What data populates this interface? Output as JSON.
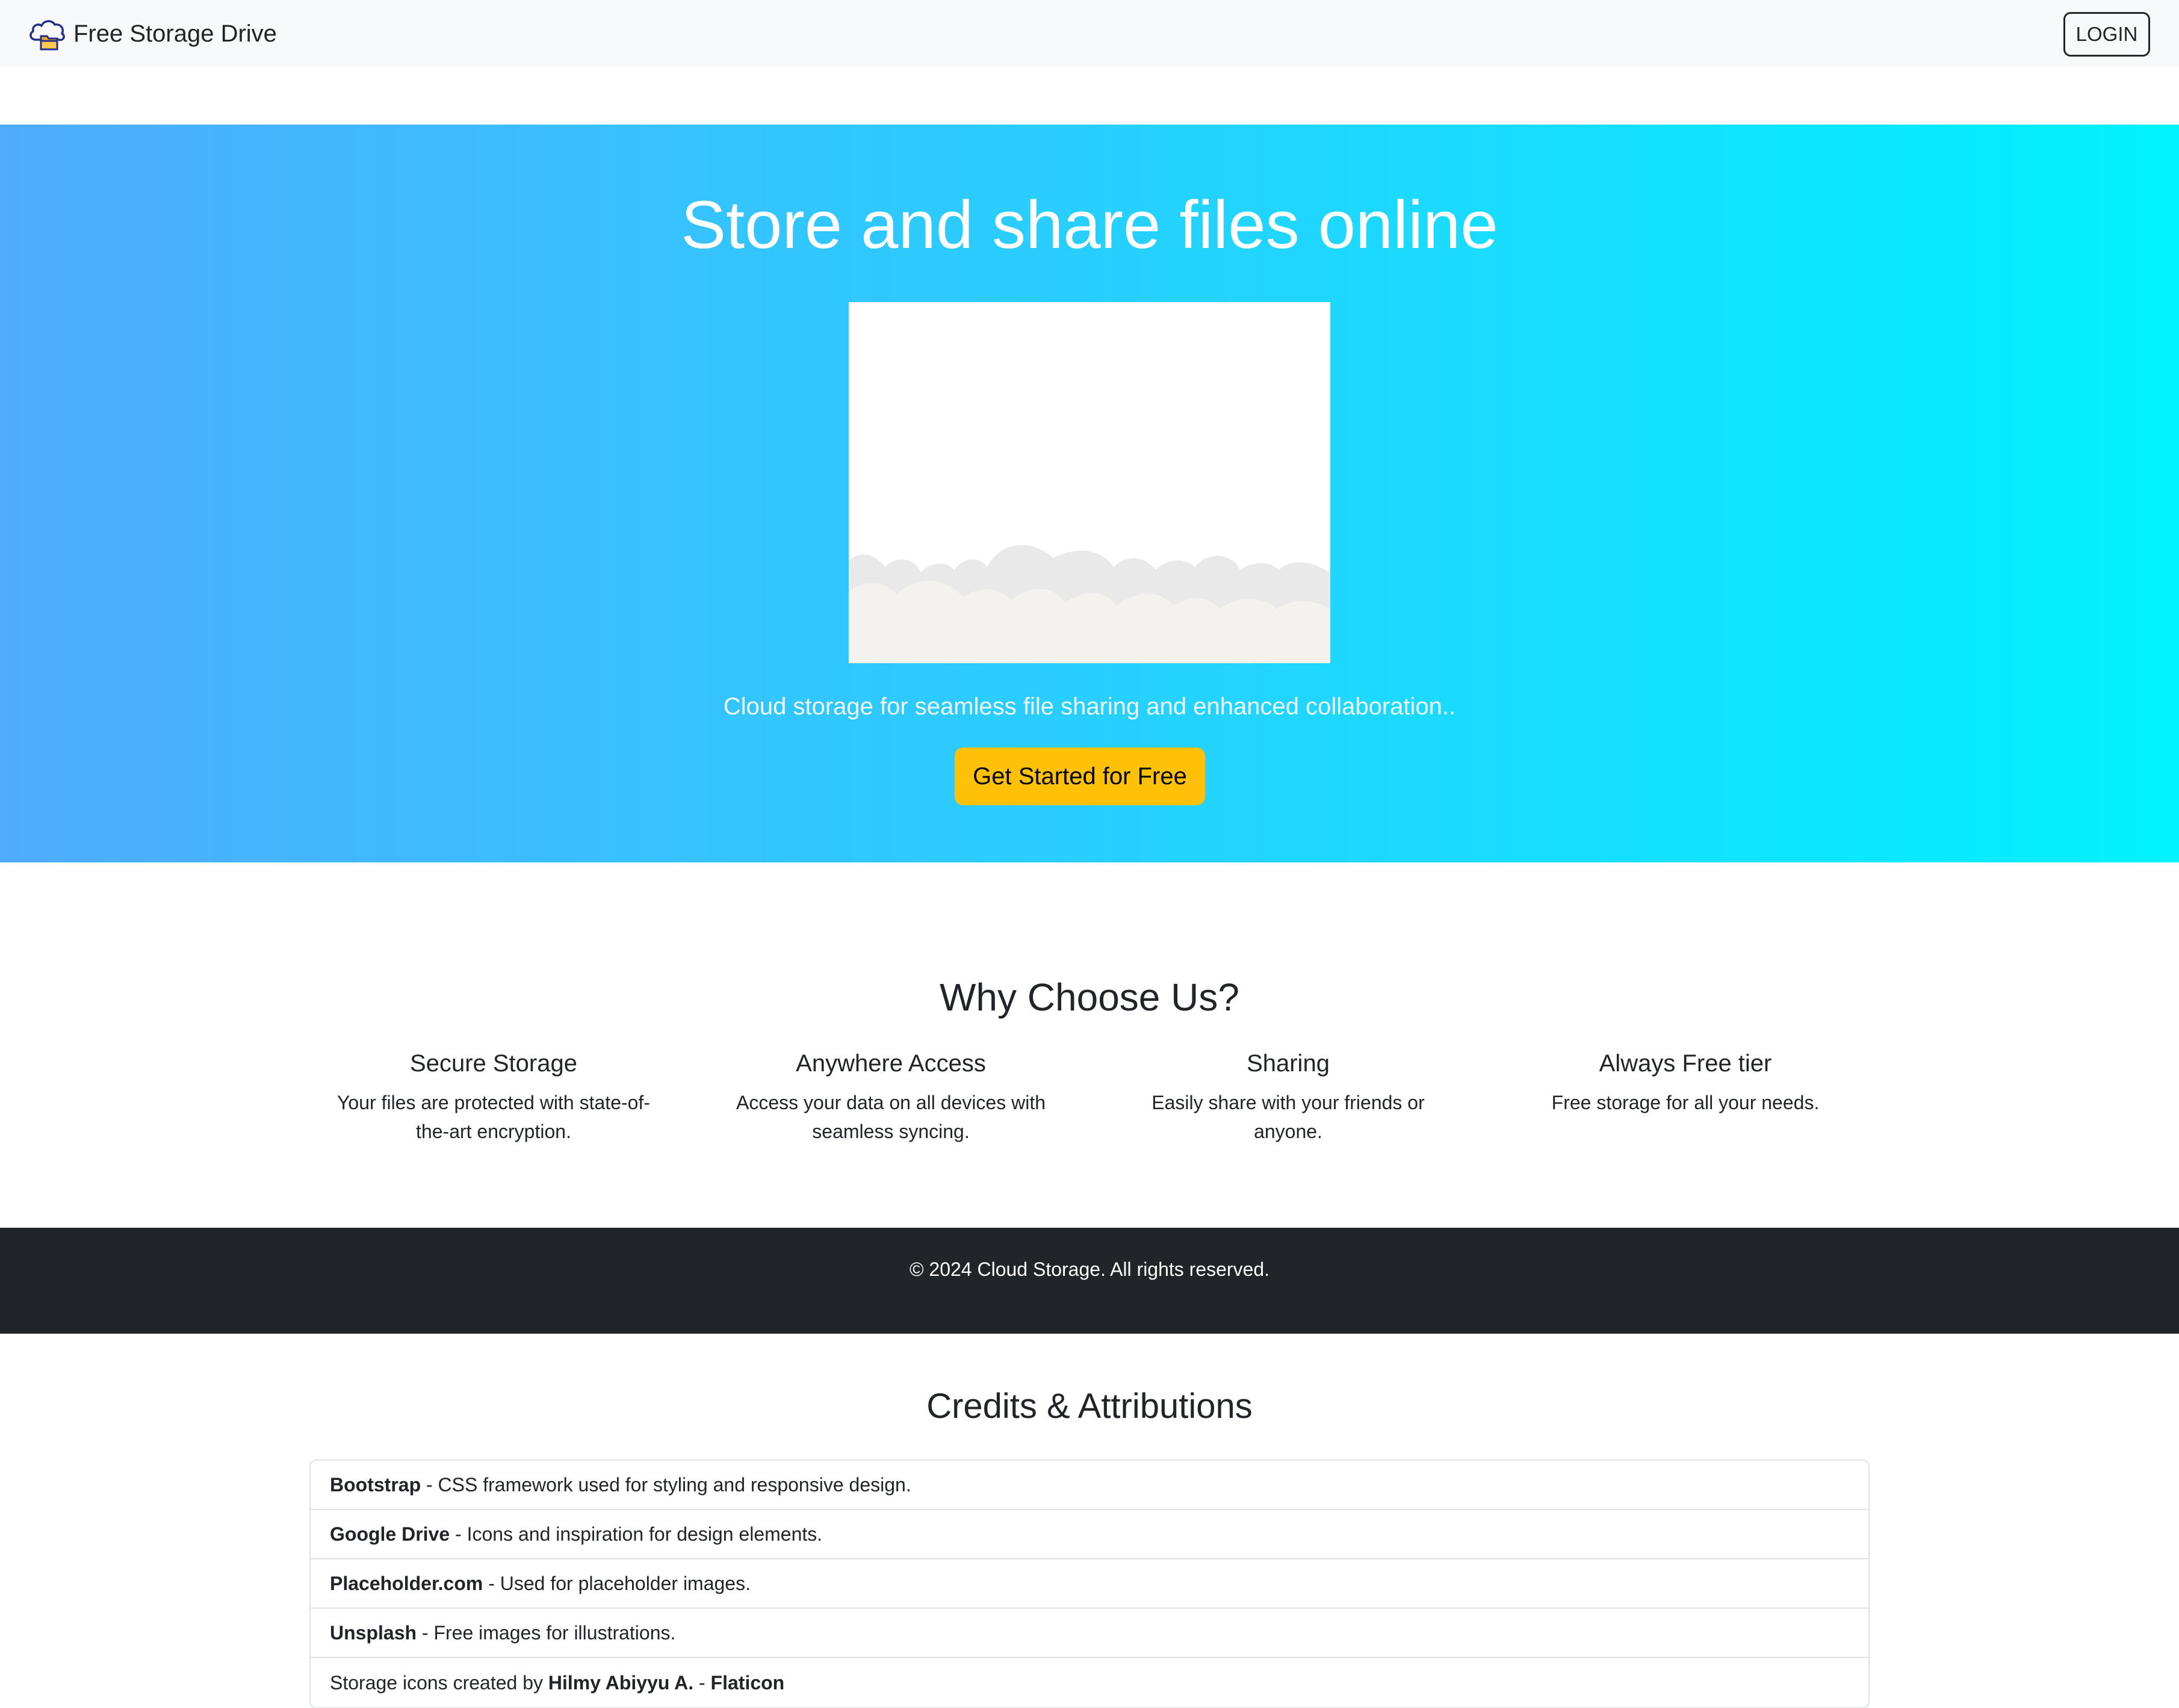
{
  "navbar": {
    "brand": "Free Storage Drive",
    "brand_icon": "cloud-folder-icon",
    "login_label": "LOGIN"
  },
  "hero": {
    "title": "Store and share files online",
    "subtitle": "Cloud storage for seamless file sharing and enhanced collaboration..",
    "cta_label": "Get Started for Free",
    "gradient_from": "#4facfe",
    "gradient_to": "#00f2fe",
    "cta_color": "#ffc107"
  },
  "why": {
    "title": "Why Choose Us?",
    "features": [
      {
        "title": "Secure Storage",
        "desc": "Your files are protected with state-of-the-art encryption."
      },
      {
        "title": "Anywhere Access",
        "desc": "Access your data on all devices with seamless syncing."
      },
      {
        "title": "Sharing",
        "desc": "Easily share with your friends or anyone."
      },
      {
        "title": "Always Free tier",
        "desc": "Free storage for all your needs."
      }
    ]
  },
  "footer": {
    "text": "© 2024 Cloud Storage. All rights reserved.",
    "background": "#212529"
  },
  "credits": {
    "title": "Credits & Attributions",
    "items": [
      {
        "name": "Bootstrap",
        "desc": " - CSS framework used for styling and responsive design."
      },
      {
        "name": "Google Drive",
        "desc": " - Icons and inspiration for design elements."
      },
      {
        "name": "Placeholder.com",
        "desc": " - Used for placeholder images."
      },
      {
        "name": "Unsplash",
        "desc": " - Free images for illustrations."
      }
    ],
    "last": {
      "prefix": "Storage icons created by ",
      "author": "Hilmy Abiyyu A.",
      "separator": " - ",
      "source": "Flaticon"
    }
  }
}
